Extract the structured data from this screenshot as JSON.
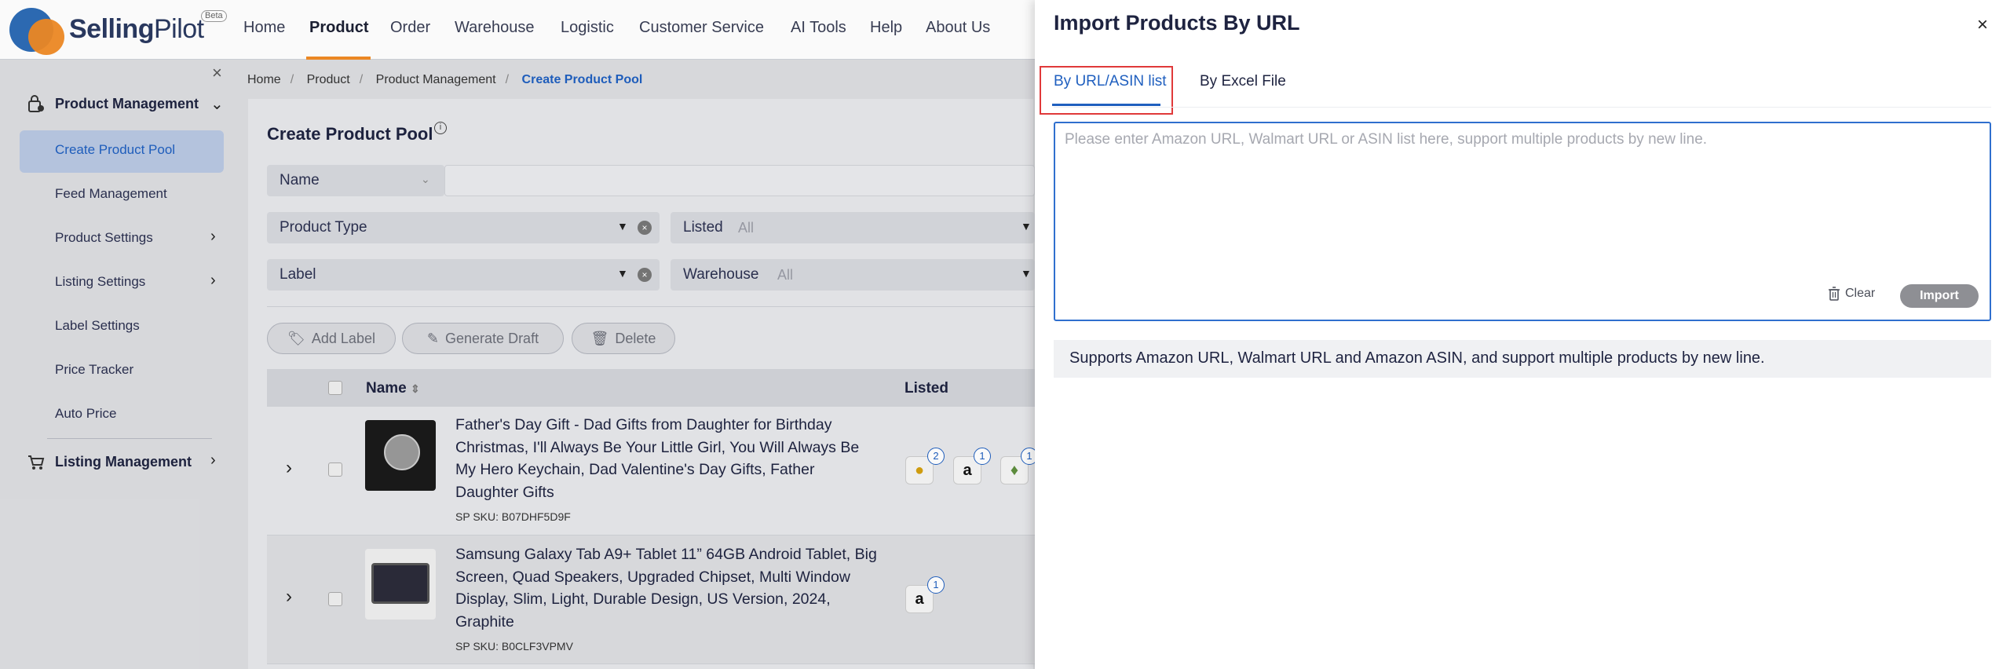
{
  "brand": {
    "name_bold": "Selling",
    "name_rest": "Pilot",
    "badge": "Beta"
  },
  "nav": {
    "items": [
      "Home",
      "Product",
      "Order",
      "Warehouse",
      "Logistic",
      "Customer Service",
      "AI Tools",
      "Help",
      "About Us"
    ],
    "active": "Product"
  },
  "sidebar": {
    "close": "×",
    "group1": "Product Management",
    "items": [
      "Create Product Pool",
      "Feed Management",
      "Product Settings",
      "Listing Settings",
      "Label Settings",
      "Price Tracker",
      "Auto Price"
    ],
    "active_item": "Create Product Pool",
    "group2": "Listing Management"
  },
  "breadcrumb": [
    "Home",
    "Product",
    "Product Management",
    "Create Product Pool"
  ],
  "page": {
    "title": "Create Product Pool",
    "filters": {
      "name_select": "Name",
      "product_type": "Product Type",
      "listed_label": "Listed",
      "listed_value": "All",
      "label": "Label",
      "warehouse_label": "Warehouse",
      "warehouse_value": "All"
    },
    "actions": {
      "add_label": "Add Label",
      "generate_draft": "Generate Draft",
      "delete": "Delete"
    },
    "table": {
      "headers": {
        "name": "Name",
        "listed": "Listed"
      },
      "rows": [
        {
          "title": "Father's Day Gift - Dad Gifts from Daughter for Birthday Christmas, I'll Always Be Your Little Girl, You Will Always Be My Hero Keychain, Dad Valentine's Day Gifts, Father Daughter Gifts",
          "sku": "SP SKU: B07DHF5D9F",
          "badges": [
            "2",
            "1",
            "1"
          ]
        },
        {
          "title": "Samsung Galaxy Tab A9+ Tablet 11” 64GB Android Tablet, Big Screen, Quad Speakers, Upgraded Chipset, Multi Window Display, Slim, Light, Durable Design, US Version, 2024, Graphite",
          "sku": "SP SKU: B0CLF3VPMV",
          "badges": [
            "1"
          ]
        }
      ]
    }
  },
  "drawer": {
    "title": "Import Products By URL",
    "close": "×",
    "tabs": [
      "By URL/ASIN list",
      "By Excel File"
    ],
    "active_tab": "By URL/ASIN list",
    "textarea_placeholder": "Please enter Amazon URL, Walmart URL or ASIN list here, support multiple products by new line.",
    "clear_label": "Clear",
    "import_label": "Import",
    "tip": "Supports Amazon URL, Walmart URL and Amazon ASIN, and support multiple products by new line."
  },
  "colors": {
    "accent": "#1f5fbf",
    "brand_orange": "#f08a24",
    "highlight_red": "#e0393a"
  }
}
